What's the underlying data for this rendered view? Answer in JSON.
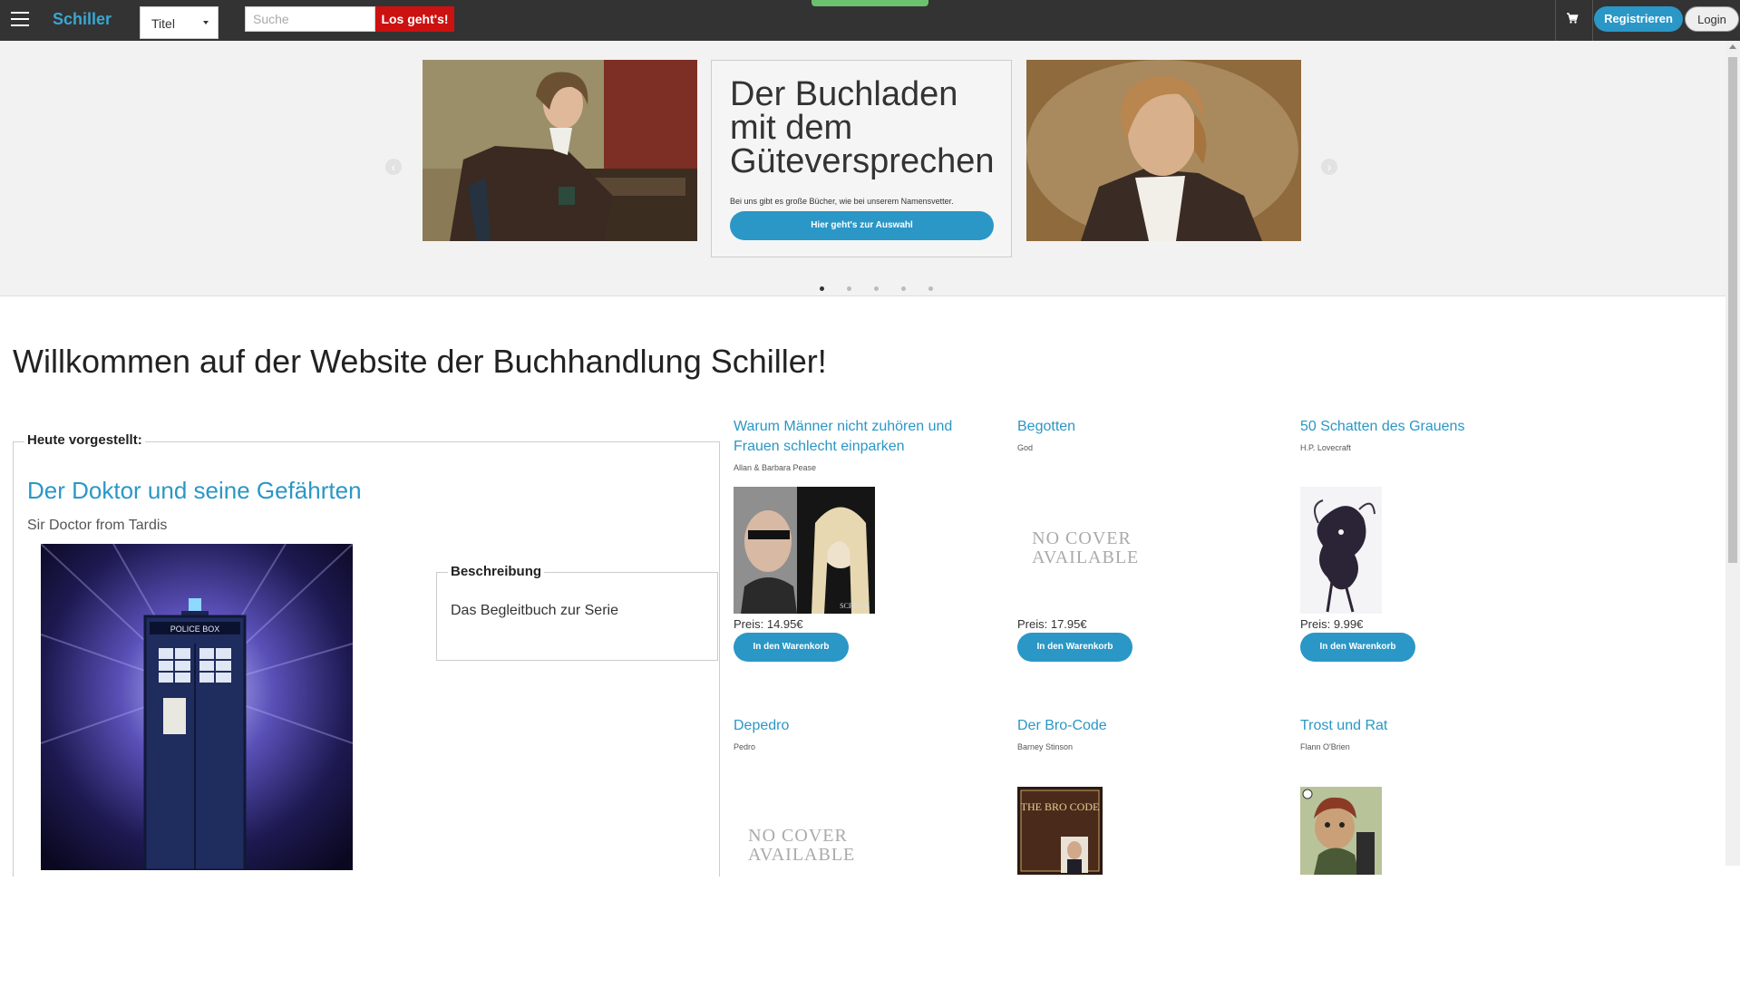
{
  "header": {
    "brand": "Schiller",
    "search_scope": "Titel",
    "search_placeholder": "Suche",
    "search_button": "Los geht's!",
    "register_button": "Registrieren",
    "login_button": "Login",
    "icons": [
      "hamburger-icon",
      "cart-icon"
    ]
  },
  "hero": {
    "title": "Der Buchladen mit dem Güteversprechen",
    "subtitle": "Bei uns gibt es große Bücher, wie bei unserem Namensvetter.",
    "cta": "Hier geht's zur Auswahl",
    "prev_glyph": "‹",
    "next_glyph": "›",
    "slide_count": 5,
    "active_slide": 1
  },
  "welcome": "Willkommen auf der Website der Buchhandlung Schiller!",
  "featured": {
    "legend": "Heute vorgestellt:",
    "title": "Der Doktor und seine Gefährten",
    "author": "Sir Doctor from Tardis",
    "cover_sign": "POLICE BOX",
    "description_legend": "Beschreibung",
    "description": "Das Begleitbuch zur Serie"
  },
  "no_cover_line1": "NO COVER",
  "no_cover_line2": "AVAILABLE",
  "products": [
    {
      "title": "Warum Männer nicht zuhören und Frauen schlecht einparken",
      "author": "Allan & Barbara Pease",
      "price": "Preis: 14.95€",
      "button": "In den Warenkorb",
      "cover_label": "SCREAM"
    },
    {
      "title": "Begotten",
      "author": "God",
      "price": "Preis: 17.95€",
      "button": "In den Warenkorb"
    },
    {
      "title": "50 Schatten des Grauens",
      "author": "H.P. Lovecraft",
      "price": "Preis: 9.99€",
      "button": "In den Warenkorb"
    },
    {
      "title": "Depedro",
      "author": "Pedro"
    },
    {
      "title": "Der Bro-Code",
      "author": "Barney Stinson",
      "cover_label": "THE BRO CODE"
    },
    {
      "title": "Trost und Rat",
      "author": "Flann O'Brien"
    }
  ],
  "colors": {
    "accent": "#2a97c6",
    "search_button": "#cc1111",
    "topbar": "#333333",
    "hero_bg": "#f2f2f2"
  }
}
